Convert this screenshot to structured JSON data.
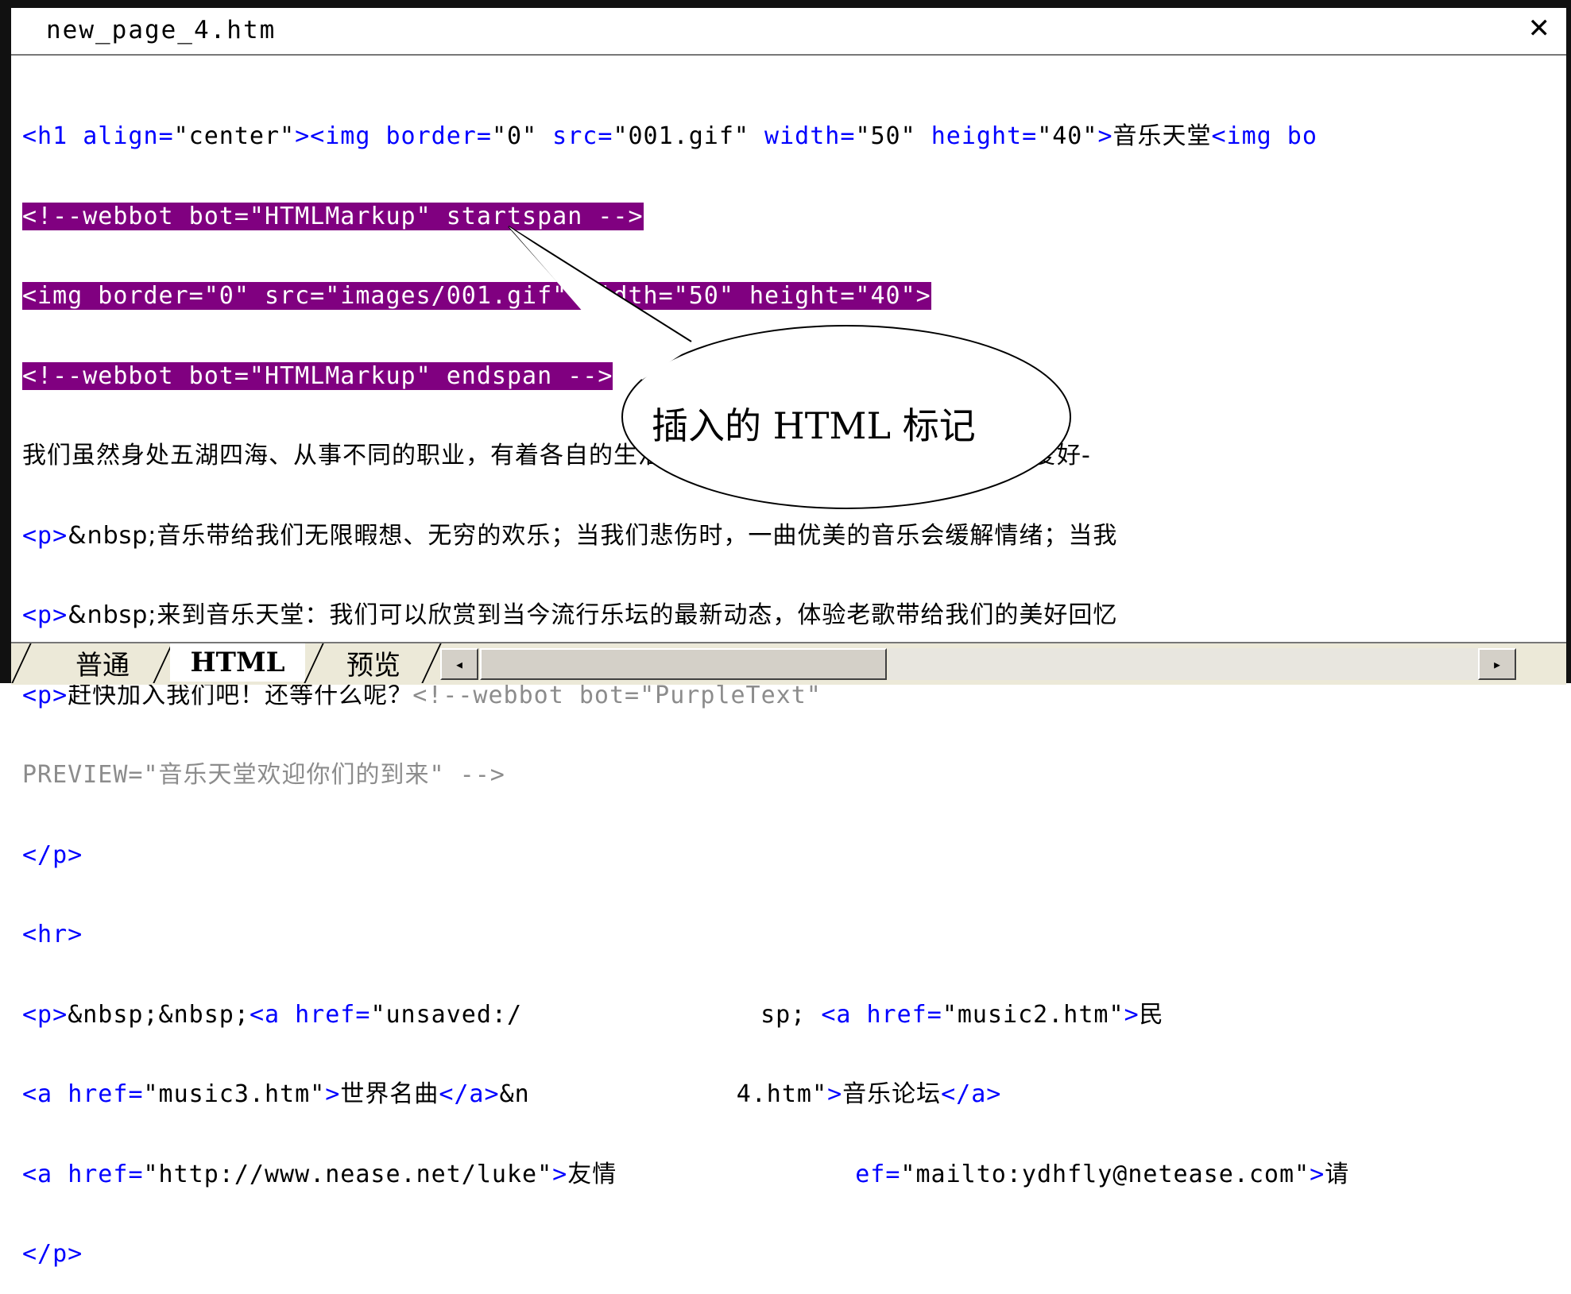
{
  "window": {
    "title": "new_page_4.htm",
    "close_glyph": "✕"
  },
  "code": {
    "l1": [
      "<h1 ",
      "align",
      "=",
      "\"center\"",
      "><img ",
      "border",
      "=",
      "\"0\"",
      " src",
      "=",
      "\"001.gif\"",
      " width",
      "=",
      "\"50\"",
      " height",
      "=",
      "\"40\"",
      ">",
      "音乐天堂",
      "<img bo"
    ],
    "l2": "<!--webbot bot=\"HTMLMarkup\" startspan -->",
    "l3": "<img border=\"0\" src=\"images/001.gif\" width=\"50\" height=\"40\">",
    "l4": "<!--webbot bot=\"HTMLMarkup\" endspan -->",
    "l5": "我们虽然身处五湖四海、从事不同的职业，有着各自的生活经历，但我们有着一个共同的兴趣爱好-",
    "l6": [
      "<p>",
      "&nbsp;音乐带给我们无限暇想、无穷的欢乐；当我们悲伤时，一曲优美的音乐会缓解情绪；当我"
    ],
    "l7": [
      "<p>",
      "&nbsp;来到音乐天堂：我们可以欣赏到当今流行乐坛的最新动态，体验老歌带给我们的美好回忆"
    ],
    "l8": [
      "<p>",
      "赶快加入我们吧！还等什么呢？",
      "<!--webbot bot=\"PurpleText\""
    ],
    "l9": "PREVIEW=\"音乐天堂欢迎你们的到来\" -->",
    "l10": "</p>",
    "l11": "<hr>",
    "l12": [
      "<p>",
      "&nbsp;&nbsp;",
      "<a ",
      "href",
      "=",
      "\"unsaved:/",
      "sp; ",
      "<a ",
      "href",
      "=",
      "\"music2.htm\"",
      ">",
      "民"
    ],
    "l13": [
      "<a ",
      "href",
      "=",
      "\"music3.htm\"",
      ">",
      "世界名曲",
      "</a>",
      "&n",
      "4.htm\"",
      ">",
      "音乐论坛",
      "</a>"
    ],
    "l14": [
      "<a ",
      "href",
      "=",
      "\"http://www.nease.net/luke\"",
      ">",
      "友情",
      "ef",
      "=",
      "\"mailto:ydhfly@netease.com\"",
      ">",
      "请"
    ],
    "l15": "</p>"
  },
  "callout": {
    "label": "插入的 HTML 标记"
  },
  "tabs": [
    {
      "label": "普通",
      "active": false
    },
    {
      "label": "HTML",
      "active": true
    },
    {
      "label": "预览",
      "active": false
    }
  ],
  "scrollbar": {
    "left_arrow": "◂",
    "right_arrow": "▸"
  }
}
